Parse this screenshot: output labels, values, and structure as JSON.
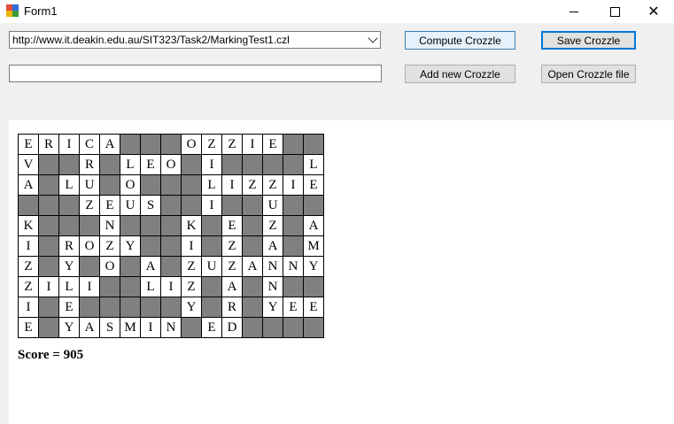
{
  "window": {
    "title": "Form1"
  },
  "toolbar": {
    "url_value": "http://www.it.deakin.edu.au/SIT323/Task2/MarkingTest1.czl",
    "second_value": "",
    "compute_label": "Compute  Crozzle",
    "save_label": "Save Crozzle",
    "add_label": "Add new Crozzle",
    "open_label": "Open Crozzle file"
  },
  "crozzle": {
    "rows": [
      [
        "E",
        "R",
        "I",
        "C",
        "A",
        "",
        "",
        "",
        "O",
        "Z",
        "Z",
        "I",
        "E",
        "",
        ""
      ],
      [
        "V",
        "",
        "",
        "R",
        "",
        "L",
        "E",
        "O",
        "",
        "I",
        "",
        "",
        "",
        "",
        "L"
      ],
      [
        "A",
        "",
        "L",
        "U",
        "",
        "O",
        "",
        "",
        "",
        "L",
        "I",
        "Z",
        "Z",
        "I",
        "E"
      ],
      [
        "",
        "",
        "",
        "Z",
        "E",
        "U",
        "S",
        "",
        "",
        "I",
        "",
        "",
        "U",
        "",
        ""
      ],
      [
        "K",
        "",
        "",
        "",
        "N",
        "",
        "",
        "",
        "K",
        "",
        "E",
        "",
        "Z",
        "",
        "A"
      ],
      [
        "I",
        "",
        "R",
        "O",
        "Z",
        "Y",
        "",
        "",
        "I",
        "",
        "Z",
        "",
        "A",
        "",
        "M"
      ],
      [
        "Z",
        "",
        "Y",
        "",
        "O",
        "",
        "A",
        "",
        "Z",
        "U",
        "Z",
        "A",
        "N",
        "N",
        "Y"
      ],
      [
        "Z",
        "I",
        "L",
        "I",
        "",
        "",
        "L",
        "I",
        "Z",
        "",
        "A",
        "",
        "N",
        "",
        ""
      ],
      [
        "I",
        "",
        "E",
        "",
        "",
        "",
        "",
        "",
        "Y",
        "",
        "R",
        "",
        "Y",
        "E",
        "E"
      ],
      [
        "E",
        "",
        "Y",
        "A",
        "S",
        "M",
        "I",
        "N",
        "",
        "E",
        "D",
        "",
        "",
        "",
        ""
      ]
    ]
  },
  "score_text": "Score = 905"
}
